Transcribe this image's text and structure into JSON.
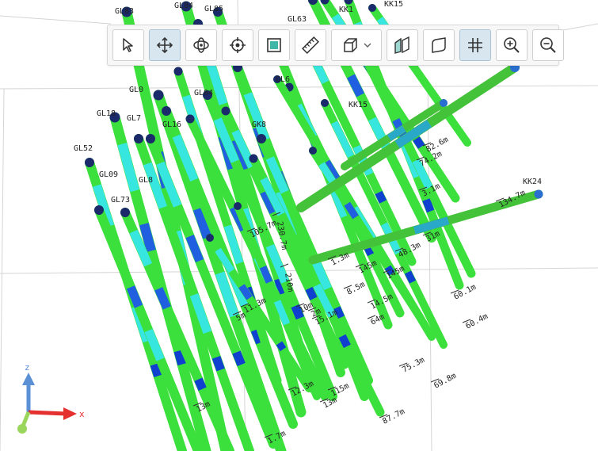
{
  "toolbar": {
    "buttons": [
      {
        "id": "select",
        "icon": "cursor-arrow-icon",
        "active": false
      },
      {
        "id": "pan",
        "icon": "move-arrows-icon",
        "active": true
      },
      {
        "id": "orbit",
        "icon": "orbit-icon",
        "active": false
      },
      {
        "id": "target",
        "icon": "crosshair-icon",
        "active": false
      },
      {
        "id": "fit",
        "icon": "fit-frame-icon",
        "active": false
      },
      {
        "id": "measure",
        "icon": "ruler-icon",
        "active": false
      },
      {
        "id": "view-cube",
        "icon": "cube-icon",
        "active": false,
        "dropdown": true
      },
      {
        "id": "section-a",
        "icon": "section-plane-icon",
        "active": false
      },
      {
        "id": "section-b",
        "icon": "section-outline-icon",
        "active": false
      },
      {
        "id": "grid",
        "icon": "grid-icon",
        "active": true
      },
      {
        "id": "zoom-in",
        "icon": "zoom-in-icon",
        "active": false
      },
      {
        "id": "zoom-out",
        "icon": "zoom-out-icon",
        "active": false
      }
    ]
  },
  "axes": {
    "z_label": "z",
    "x_label": "x",
    "z_color": "#5b8fd6",
    "x_color": "#e53030",
    "y_color": "#9ad65b"
  },
  "colors": {
    "green": "#3ce03c",
    "cyan": "#38e6e0",
    "blue": "#1f5fe0",
    "deep_blue": "#1040d0"
  },
  "hole_labels": [
    "GL83",
    "GL84",
    "GL85",
    "GL63",
    "KK1",
    "KK15",
    "GL0",
    "GL04",
    "GL18",
    "GL7",
    "GL16",
    "GL52",
    "GL09",
    "GL73",
    "GL8",
    "GK8",
    "GL6",
    "KK15",
    "KK24"
  ],
  "depth_labels": [
    "82.6m",
    "74.2m",
    "3.1m",
    "134.7m",
    "48.3m",
    "31m",
    "60.1m",
    "60.4m",
    "75.3m",
    "69.8m",
    "87.7m",
    "145m",
    "14.5m",
    "210m",
    "105.7m",
    "230.7m",
    "15.1m",
    "11.3m",
    "12.3m",
    "5m",
    "10m",
    "1.3m",
    "115m",
    "13m",
    "145m",
    "64m",
    "8.5m",
    "2m",
    "13m",
    "1.7m"
  ]
}
